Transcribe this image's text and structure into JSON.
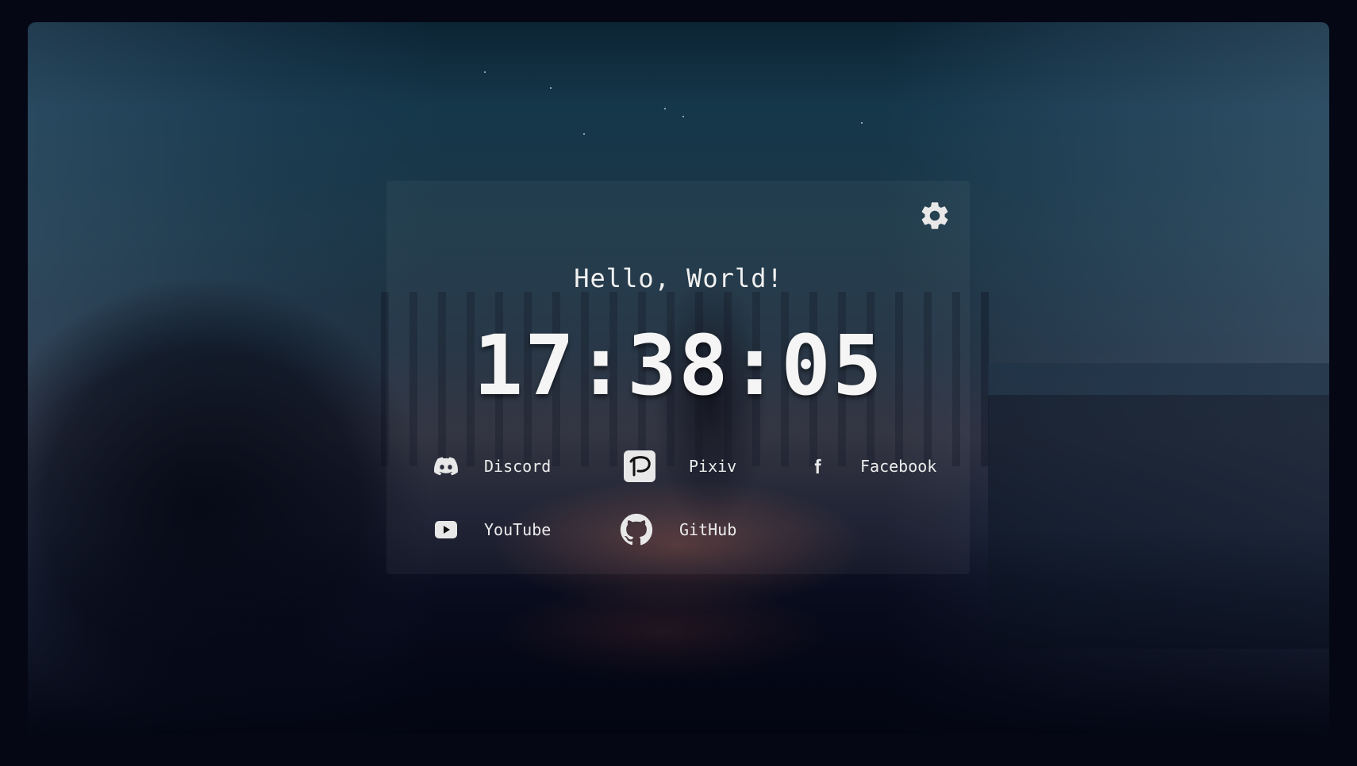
{
  "greeting": "Hello, World!",
  "clock": {
    "time": "17:38:05"
  },
  "settings": {
    "icon": "gear-icon"
  },
  "links": [
    {
      "label": "Discord",
      "icon": "discord-icon"
    },
    {
      "label": "Pixiv",
      "icon": "pixiv-icon"
    },
    {
      "label": "Facebook",
      "icon": "facebook-icon"
    },
    {
      "label": "YouTube",
      "icon": "youtube-icon"
    },
    {
      "label": "GitHub",
      "icon": "github-icon"
    }
  ],
  "colors": {
    "text": "#f1f1f1",
    "background": "#050814",
    "icon": "#e8e8e8"
  }
}
